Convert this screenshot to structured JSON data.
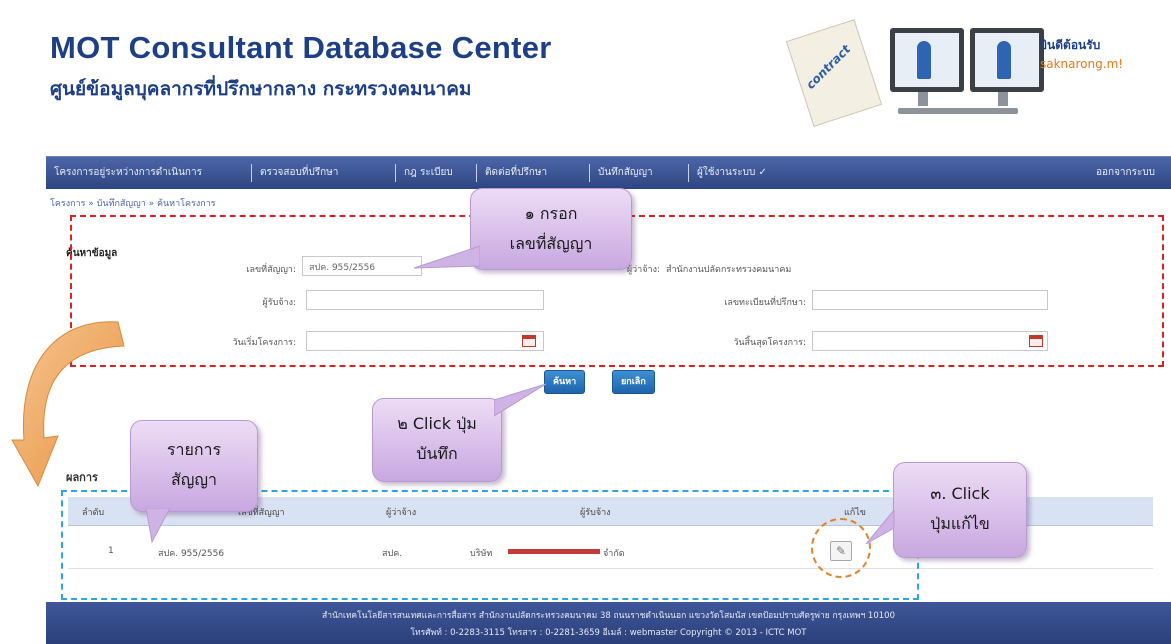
{
  "header": {
    "title": "MOT Consultant Database Center",
    "subtitle": "ศูนย์ข้อมูลบุคลากรที่ปรึกษากลาง กระทรวงคมนาคม",
    "welcome": "ยินดีต้อนรับ",
    "username": "saknarong.m!",
    "graphic_text": "contract"
  },
  "nav": {
    "items": [
      "โครงการอยู่ระหว่างการดำเนินการ",
      "ตรวจสอบที่ปรึกษา",
      "กฎ ระเบียบ",
      "ติดต่อที่ปรึกษา",
      "บันทึกสัญญา",
      "ผู้ใช้งานระบบ ✓"
    ],
    "logout": "ออกจากระบบ"
  },
  "breadcrumb": "โครงการ » บันทึกสัญญา » ค้นหาโครงการ",
  "search": {
    "section_title": "ค้นหาข้อมูล",
    "contract_no_label": "เลขที่สัญญา:",
    "contract_no_value": "สปค. 955/2556",
    "employer_label": "ผู้ว่าจ้าง:",
    "employer_value": "สำนักงานปลัดกระทรวงคมนาคม",
    "consultant_label": "ผู้รับจ้าง:",
    "reg_no_label": "เลขทะเบียนที่ปรึกษา:",
    "start_date_label": "วันเริ่มโครงการ:",
    "end_date_label": "วันสิ้นสุดโครงการ:",
    "search_button": "ค้นหา",
    "clear_button": "ยกเลิก"
  },
  "results": {
    "label": "ผลการ",
    "columns": [
      "ลำดับ",
      "เลขที่สัญญา",
      "ผู้ว่าจ้าง",
      "ผู้รับจ้าง",
      "แก้ไข"
    ],
    "rows": [
      {
        "no": "1",
        "contract": "สปค. 955/2556",
        "employer": "สปค.",
        "consultant_prefix": "บริษัท",
        "consultant_suffix": "จำกัด"
      }
    ]
  },
  "footer": {
    "line1": "สำนักเทคโนโลยีสารสนเทศและการสื่อสาร สำนักงานปลัดกระทรวงคมนาคม 38 ถนนราชดำเนินนอก แขวงวัดโสมนัส เขตป้อมปราบศัตรูพ่าย กรุงเทพฯ 10100",
    "line2": "โทรศัพท์ : 0-2283-3115   โทรสาร : 0-2281-3659   อีเมล์ : webmaster   Copyright © 2013 - ICTC MOT"
  },
  "callouts": {
    "step1_line1": "๑ กรอก",
    "step1_line2": "เลขที่สัญญา",
    "step2_line1": "๒ Click ปุ่ม",
    "step2_line2": "บันทึก",
    "list_line1": "รายการ",
    "list_line2": "สัญญา",
    "step3_line1": "๓. Click",
    "step3_line2": "ปุ่มแก้ไข"
  },
  "colors": {
    "title_blue": "#1d3f86",
    "nav_blue": "#2d4582",
    "callout_purple": "#c8a8e0",
    "red_frame": "#e02020",
    "blue_frame": "#2aa6e0",
    "orange": "#e0842a"
  }
}
